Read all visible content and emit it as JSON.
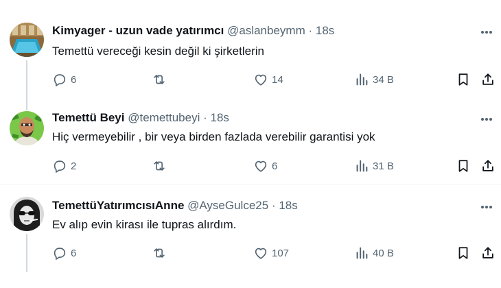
{
  "tweets": [
    {
      "name": "Kimyager - uzun vade yatırımcı",
      "handle": "@aslanbeymm",
      "separator": "·",
      "time": "18s",
      "text": "Temettü vereceği kesin değil ki şirketlerin",
      "replies": "6",
      "likes": "14",
      "views": "34 B",
      "avatar_icon": "pool-photo"
    },
    {
      "name": "Temettü Beyi",
      "handle": "@temettubeyi",
      "separator": "·",
      "time": "18s",
      "text": "Hiç vermeyebilir , bir veya birden fazlada verebilir garantisi yok",
      "replies": "2",
      "likes": "6",
      "views": "31 B",
      "avatar_icon": "bald-man-with-money-illustration"
    },
    {
      "name": "TemettüYatırımcısıAnne",
      "handle": "@AyseGulce25",
      "separator": "·",
      "time": "18s",
      "text": "Ev alıp evin kirası ile tupras alırdım.",
      "replies": "6",
      "likes": "107",
      "views": "40 B",
      "avatar_icon": "woman-sunglasses-bw-photo"
    }
  ],
  "colors": {
    "text": "#0f1419",
    "secondary": "#536471",
    "thread_line": "#cfd9de",
    "divider": "#eff3f4"
  },
  "icons": [
    "reply-icon",
    "retweet-icon",
    "like-icon",
    "views-icon",
    "bookmark-icon",
    "share-icon",
    "more-icon"
  ]
}
